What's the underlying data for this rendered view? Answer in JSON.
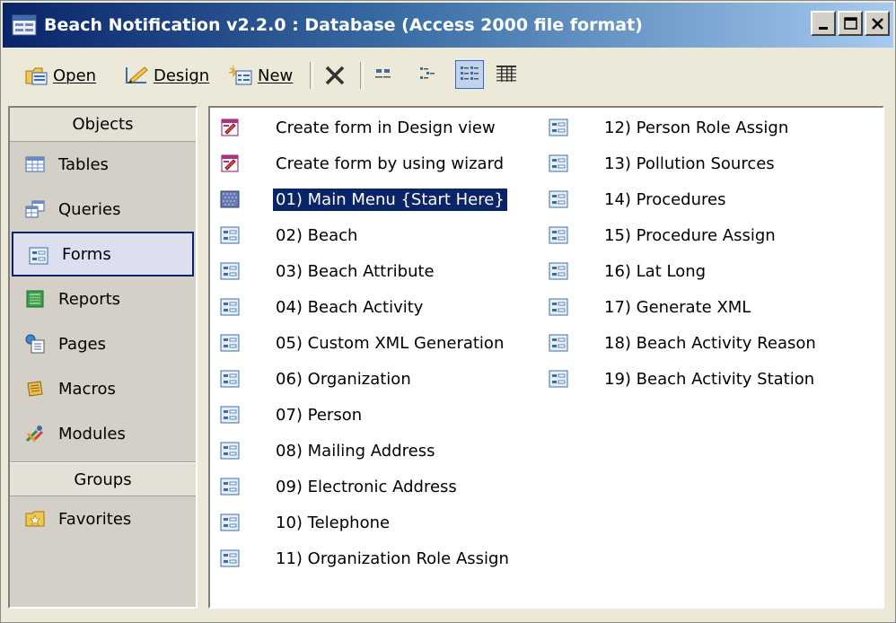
{
  "window": {
    "title": "Beach Notification v2.2.0 : Database (Access 2000 file format)",
    "icon": "database-window-icon"
  },
  "toolbar": {
    "open_label": "Open",
    "design_label": "Design",
    "new_label": "New"
  },
  "objects": {
    "header": "Objects",
    "items": [
      {
        "label": "Tables",
        "icon": "table-icon"
      },
      {
        "label": "Queries",
        "icon": "query-icon"
      },
      {
        "label": "Forms",
        "icon": "form-icon",
        "selected": true
      },
      {
        "label": "Reports",
        "icon": "report-icon"
      },
      {
        "label": "Pages",
        "icon": "page-icon"
      },
      {
        "label": "Macros",
        "icon": "macro-icon"
      },
      {
        "label": "Modules",
        "icon": "module-icon"
      }
    ],
    "groups_header": "Groups",
    "groups": [
      {
        "label": "Favorites",
        "icon": "favorites-folder-icon"
      }
    ]
  },
  "forms_list": {
    "column1": [
      {
        "label": "Create form in Design view",
        "icon": "create-form-icon"
      },
      {
        "label": "Create form by using wizard",
        "icon": "create-form-icon"
      },
      {
        "label": "01) Main Menu {Start Here}",
        "icon": "switchboard-form-icon",
        "selected": true
      },
      {
        "label": "02) Beach",
        "icon": "form-icon"
      },
      {
        "label": "03) Beach Attribute",
        "icon": "form-icon"
      },
      {
        "label": "04) Beach Activity",
        "icon": "form-icon"
      },
      {
        "label": "05) Custom XML Generation",
        "icon": "form-icon"
      },
      {
        "label": "06) Organization",
        "icon": "form-icon"
      },
      {
        "label": "07) Person",
        "icon": "form-icon"
      },
      {
        "label": "08) Mailing Address",
        "icon": "form-icon"
      },
      {
        "label": "09) Electronic Address",
        "icon": "form-icon"
      },
      {
        "label": "10) Telephone",
        "icon": "form-icon"
      },
      {
        "label": "11) Organization Role Assign",
        "icon": "form-icon"
      }
    ],
    "column2": [
      {
        "label": "12) Person Role Assign",
        "icon": "form-icon"
      },
      {
        "label": "13) Pollution Sources",
        "icon": "form-icon"
      },
      {
        "label": "14) Procedures",
        "icon": "form-icon"
      },
      {
        "label": "15) Procedure Assign",
        "icon": "form-icon"
      },
      {
        "label": "16) Lat Long",
        "icon": "form-icon"
      },
      {
        "label": "17) Generate XML",
        "icon": "form-icon"
      },
      {
        "label": "18) Beach Activity Reason",
        "icon": "form-icon"
      },
      {
        "label": "19) Beach Activity Station",
        "icon": "form-icon"
      }
    ]
  },
  "colors": {
    "titlebar_start": "#0a246a",
    "titlebar_end": "#a6caf0",
    "selection": "#0a246a"
  }
}
